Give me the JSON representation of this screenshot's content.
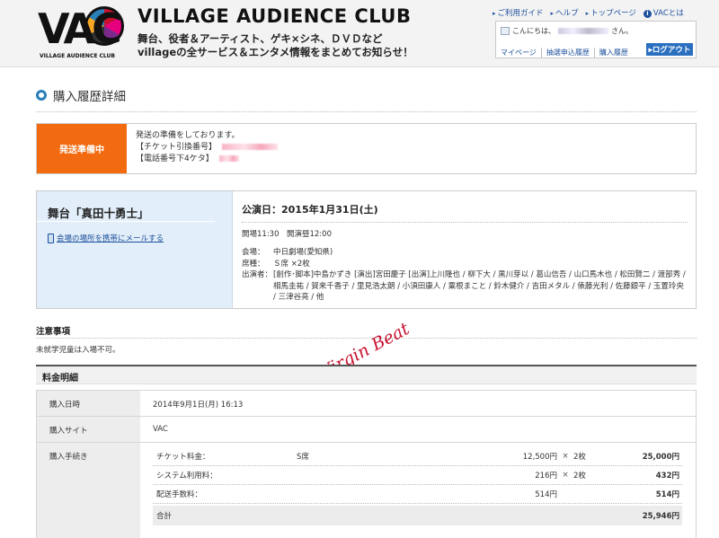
{
  "header": {
    "logo_letters": "VAC",
    "logo_caption": "VILLAGE AUDIENCE CLUB",
    "brand_title": "VILLAGE AUDIENCE CLUB",
    "tagline_line1": "舞台、役者＆アーティスト、ゲキ×シネ、ＤＶＤなど",
    "tagline_line2": "villageの全サービス＆エンタメ情報をまとめてお知らせ！",
    "top_nav": [
      {
        "label": "ご利用ガイド",
        "icon": "triangle-icon"
      },
      {
        "label": "ヘルプ",
        "icon": "triangle-icon"
      },
      {
        "label": "トップページ",
        "icon": "triangle-icon"
      },
      {
        "label": "VACとは",
        "icon": "info-icon"
      }
    ],
    "user": {
      "greeting_prefix": "こんにちは、",
      "greeting_suffix": "さん。",
      "links": [
        "マイページ",
        "抽選申込履歴",
        "購入履歴"
      ],
      "logout_label": "▸ログアウト"
    }
  },
  "page_title": "購入履歴詳細",
  "status": {
    "badge": "発送準備中",
    "message": "発送の準備をしております。",
    "ticket_label": "【チケット引換番号】",
    "phone_label": "【電話番号下4ケタ】",
    "badge_color": "#f26b10"
  },
  "event": {
    "title": "舞台「真田十勇士」",
    "mail_link": "会場の場所を携帯にメールする",
    "performance_date": "公演日：2015年1月31日(土)",
    "open_time": "開場11:30　開演昼12:00",
    "venue_label": "会場：",
    "venue": "中日劇場(愛知県)",
    "seat_label": "席種：",
    "seat": "Ｓ席 ×2枚",
    "cast_label": "出演者：",
    "cast": "[創作･脚本]中島かずき [演出]宮田慶子 [出演]上川隆也 / 柳下大 / 黒川芽以 / 葛山信吾 / 山口馬木也 / 松田賢二 / 渡部秀 / 相馬圭祐 / 賀来千香子 / 里見浩太朗 / 小須田康人 / 粟根まこと / 鈴木健介 / 吉田メタル / 俵藤光利 / 佐藤銀平 / 玉置玲央 / 三津谷亮 / 他"
  },
  "notes": {
    "heading": "注意事項",
    "text": "未就学児童は入場不可。"
  },
  "watermark": "Virgin Beat",
  "fees": {
    "heading": "料金明細",
    "purchase_date_label": "購入日時",
    "purchase_date": "2014年9月1日(月) 16:13",
    "site_label": "購入サイト",
    "site": "VAC",
    "procedure_label": "購入手続き",
    "items": [
      {
        "name": "チケット料金：",
        "seat": "S席",
        "price": "12,500円",
        "times": "×",
        "qty": "2枚",
        "subtotal": "25,000円"
      },
      {
        "name": "システム利用料：",
        "seat": "",
        "price": "216円",
        "times": "×",
        "qty": "2枚",
        "subtotal": "432円"
      },
      {
        "name": "配送手数料：",
        "seat": "",
        "price": "514円",
        "times": "",
        "qty": "",
        "subtotal": "514円"
      }
    ],
    "total_label": "合計",
    "total": "25,946円"
  }
}
